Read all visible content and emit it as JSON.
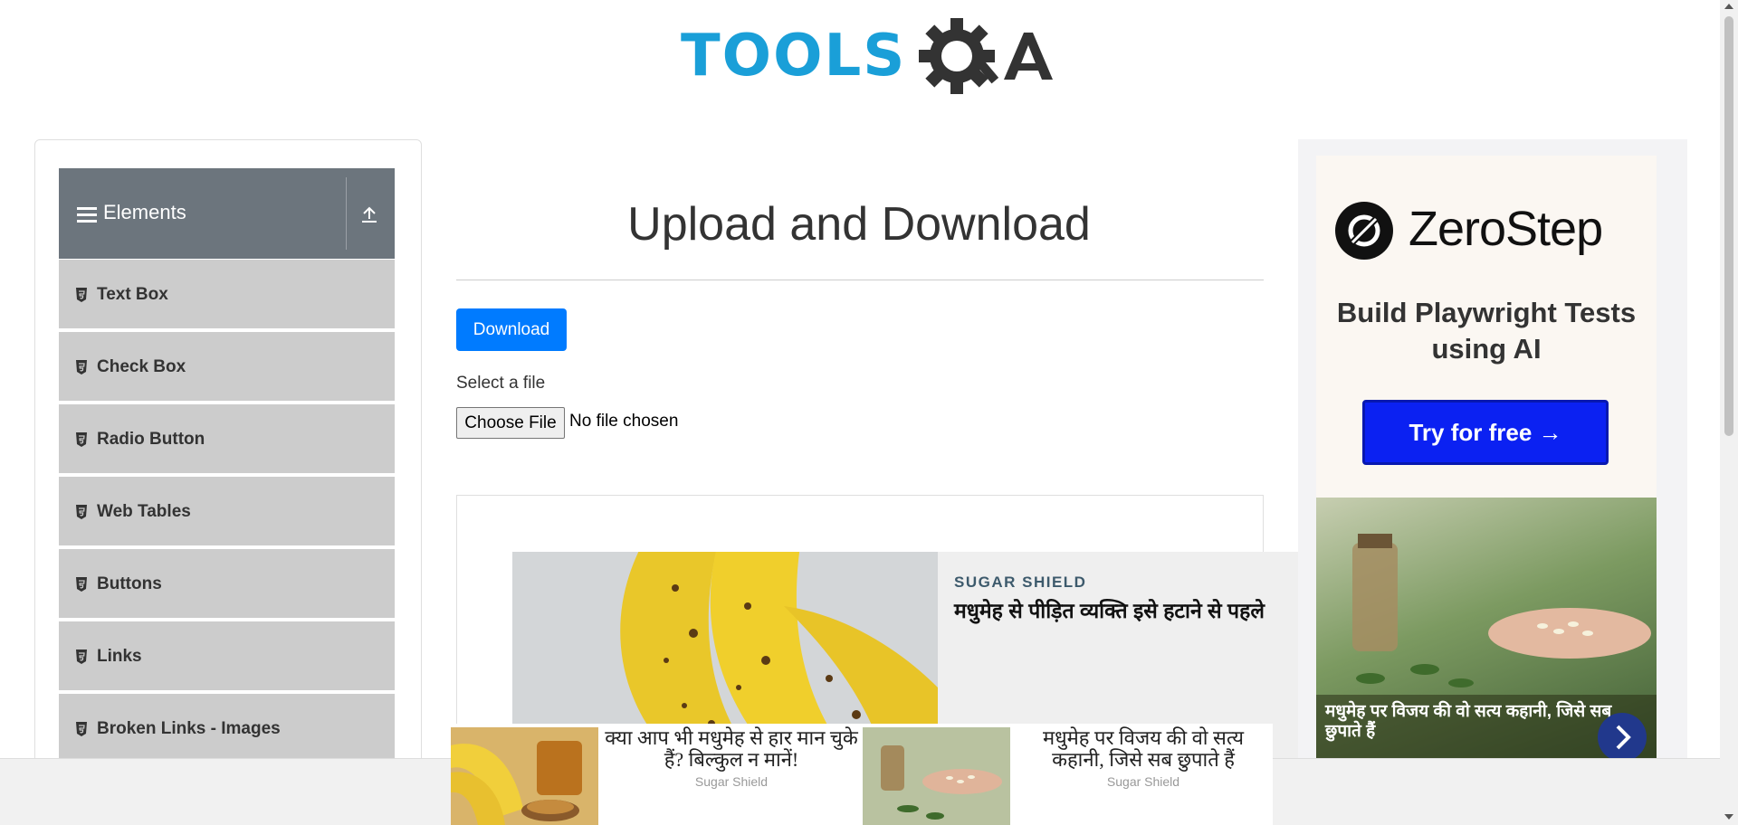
{
  "header": {
    "logo_text": "TOOLS",
    "logo_qa": "QA"
  },
  "sidebar": {
    "group_title": "Elements",
    "items": [
      {
        "label": "Text Box"
      },
      {
        "label": "Check Box"
      },
      {
        "label": "Radio Button"
      },
      {
        "label": "Web Tables"
      },
      {
        "label": "Buttons"
      },
      {
        "label": "Links"
      },
      {
        "label": "Broken Links - Images"
      }
    ]
  },
  "main": {
    "title": "Upload and Download",
    "download_label": "Download",
    "select_label": "Select a file",
    "choose_label": "Choose File",
    "no_file": "No file chosen"
  },
  "content_ad": {
    "brand": "SUGAR SHIELD",
    "headline": "मधुमेह से पीड़ित व्यक्ति इसे हटाने से पहले"
  },
  "right_ad": {
    "brand": "ZeroStep",
    "tagline": "Build Playwright Tests using AI",
    "cta": "Try for free →",
    "photo_caption": "मधुमेह पर विजय की वो सत्य कहानी, जिसे सब छुपाते हैं"
  },
  "bottom_ad": {
    "items": [
      {
        "text": "क्या आप भी मधुमेह से हार मान चुके हैं? बिल्कुल न मानें!",
        "source": "Sugar Shield"
      },
      {
        "text": "मधुमेह पर विजय की वो सत्य कहानी, जिसे सब छुपाते हैं",
        "source": "Sugar Shield"
      }
    ]
  },
  "colors": {
    "primary": "#007bff",
    "sidebar_header": "#6c757d",
    "menu_item": "#cccccc",
    "logo_blue": "#1a9fd8",
    "cta_blue": "#0b21f2"
  },
  "icons": [
    "hamburger-icon",
    "collapse-up-icon",
    "html5-icon",
    "zerostep-logo-icon",
    "chevron-right-icon"
  ]
}
